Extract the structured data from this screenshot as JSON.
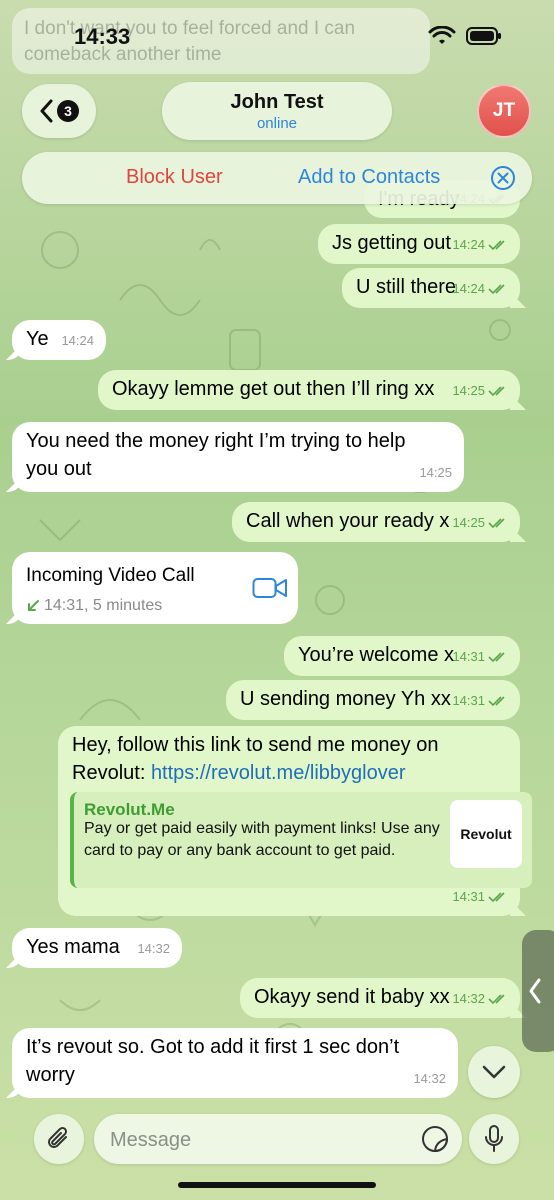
{
  "status_bar": {
    "time": "14:33"
  },
  "background_message": "I don't want you to feel forced and I can comeback another time",
  "header": {
    "unread_count": "3",
    "contact_name": "John Test",
    "contact_status": "online",
    "avatar_initials": "JT"
  },
  "action_bar": {
    "block_label": "Block User",
    "add_label": "Add to Contacts"
  },
  "messages": [
    {
      "dir": "out",
      "text": "I'm ready",
      "time": "14:24"
    },
    {
      "dir": "out",
      "text": "Js getting out",
      "time": "14:24"
    },
    {
      "dir": "out",
      "text": "U still there",
      "time": "14:24"
    },
    {
      "dir": "in",
      "text": "Ye",
      "time": "14:24"
    },
    {
      "dir": "out",
      "text": "Okayy lemme get out then I’ll ring xx",
      "time": "14:25"
    },
    {
      "dir": "in",
      "text_line1": "You need the money right I’m trying to help",
      "text_line2": "you out",
      "time": "14:25"
    },
    {
      "dir": "out",
      "text": "Call when your ready x",
      "time": "14:25"
    },
    {
      "dir": "out",
      "text": "You’re welcome x",
      "time": "14:31"
    },
    {
      "dir": "out",
      "text": "U sending money Yh xx",
      "time": "14:31"
    },
    {
      "dir": "out",
      "text_line1": "Hey, follow this link to send me money on",
      "text_prefix": "Revolut: ",
      "link": "https://revolut.me/libbyglover",
      "time": "14:31"
    },
    {
      "dir": "in",
      "text": "Yes mama",
      "time": "14:32"
    },
    {
      "dir": "out",
      "text": "Okayy send it baby xx",
      "time": "14:32"
    },
    {
      "dir": "in",
      "text_line1": "It’s revout so. Got to add it first 1 sec don’t",
      "text_line2": "worry",
      "time": "14:32"
    }
  ],
  "call": {
    "title": "Incoming Video Call",
    "detail": "14:31, 5 minutes"
  },
  "link_preview": {
    "site": "Revolut.Me",
    "description": "Pay or get paid easily with payment links! Use any card to pay or any bank account to get paid.",
    "thumb_text": "Revolut"
  },
  "composer": {
    "placeholder": "Message"
  },
  "colors": {
    "outgoing": "#e2f7c9",
    "incoming": "#ffffff",
    "accent": "#2d86d9",
    "danger": "#e0463d",
    "tick": "#5aa64c"
  }
}
